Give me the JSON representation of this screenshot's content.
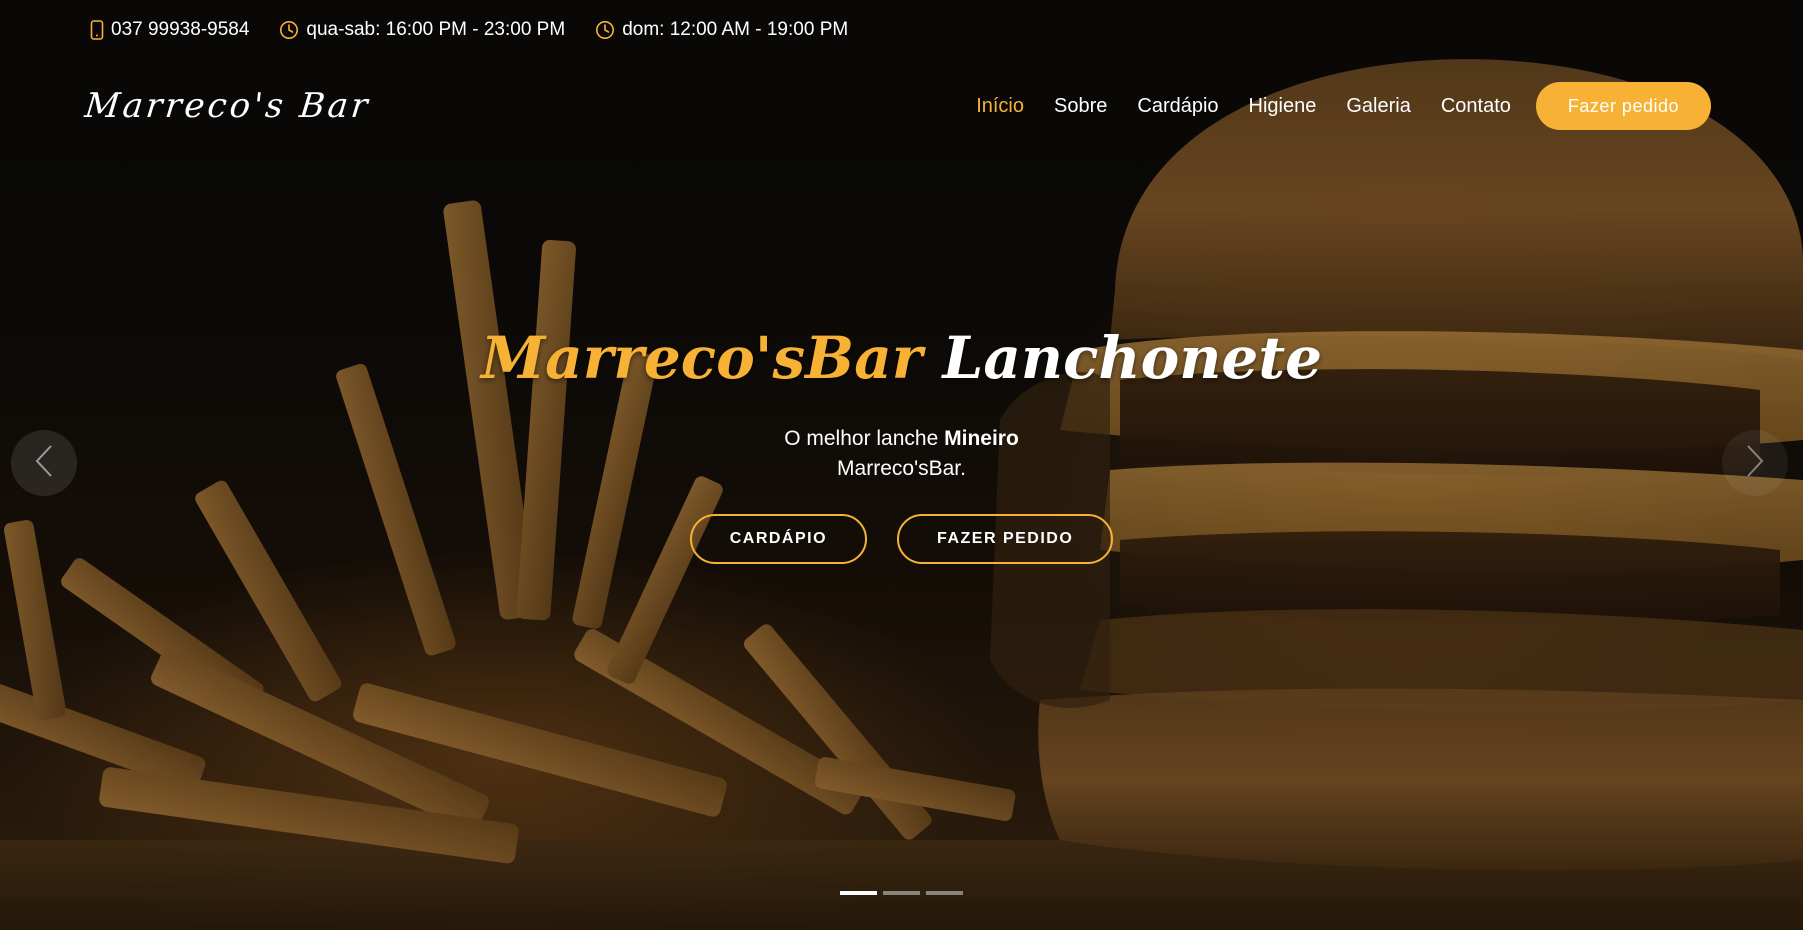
{
  "topbar": {
    "phone": "037 99938-9584",
    "hours_weekdays": "qua-sab: 16:00 PM - 23:00 PM",
    "hours_sunday": "dom: 12:00 AM - 19:00 PM",
    "phone_icon": "phone-icon",
    "clock_icon": "clock-icon"
  },
  "header": {
    "logo": "Marreco's Bar",
    "nav": [
      {
        "label": "Início",
        "active": true
      },
      {
        "label": "Sobre"
      },
      {
        "label": "Cardápio"
      },
      {
        "label": "Higiene"
      },
      {
        "label": "Galeria"
      },
      {
        "label": "Contato"
      }
    ],
    "order_button": "Fazer pedido"
  },
  "hero": {
    "title_accent": "Marreco'sBar",
    "title_rest": "Lanchonete",
    "subtitle_prefix": "O melhor lanche",
    "subtitle_bold": "Mineiro",
    "subtitle_line2": "Marreco'sBar.",
    "menu_button": "CARDÁPIO",
    "order_button": "FAZER PEDIDO"
  },
  "carousel": {
    "prev_icon": "chevron-left-icon",
    "next_icon": "chevron-right-icon",
    "slide_count": 3,
    "active_slide": 1
  },
  "colors": {
    "accent": "#f7b236",
    "text": "#ffffff",
    "background": "#0c0b0a"
  }
}
